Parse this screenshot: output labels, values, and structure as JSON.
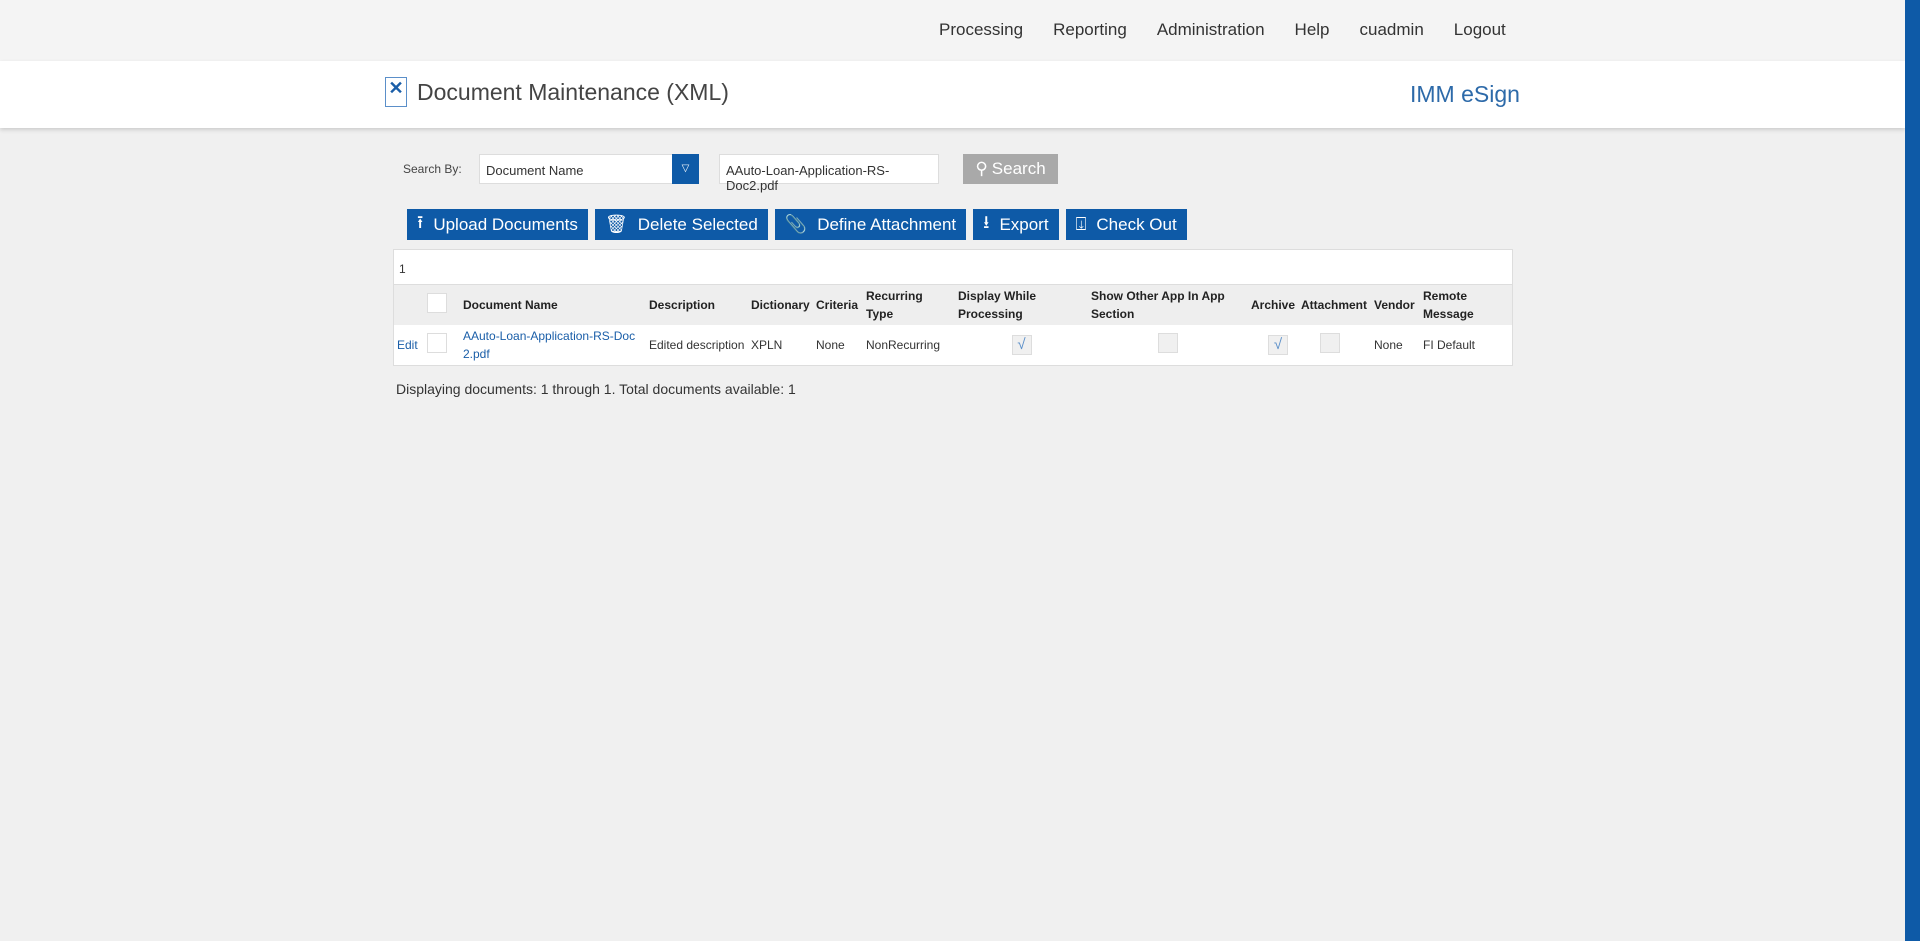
{
  "nav": [
    "Processing",
    "Reporting",
    "Administration",
    "Help",
    "cuadmin",
    "Logout"
  ],
  "header": {
    "title": "Document Maintenance (XML)",
    "brand": "IMM eSign"
  },
  "search": {
    "label": "Search By:",
    "field": "Document Name",
    "value": "AAuto-Loan-Application-RS-Doc2.pdf",
    "button": "Search"
  },
  "actions": [
    "Upload Documents",
    "Delete Selected",
    "Define Attachment",
    "Export",
    "Check Out"
  ],
  "grid": {
    "page": "1",
    "columns": [
      "Document Name",
      "Description",
      "Dictionary",
      "Criteria",
      "Recurring Type",
      "Display While Processing",
      "Show Other App In App Section",
      "Archive",
      "Attachment",
      "Vendor",
      "Remote Message"
    ],
    "rows": [
      {
        "edit": "Edit",
        "name": "AAuto-Loan-Application-RS-Doc2.pdf",
        "description": "Edited description",
        "dictionary": "XPLN",
        "criteria": "None",
        "recurring": "NonRecurring",
        "display_while_processing": true,
        "show_other_app": false,
        "archive": true,
        "attachment": false,
        "vendor": "None",
        "remote_message": "FI Default"
      }
    ]
  },
  "footer": "Displaying documents: 1 through 1. Total documents available: 1"
}
